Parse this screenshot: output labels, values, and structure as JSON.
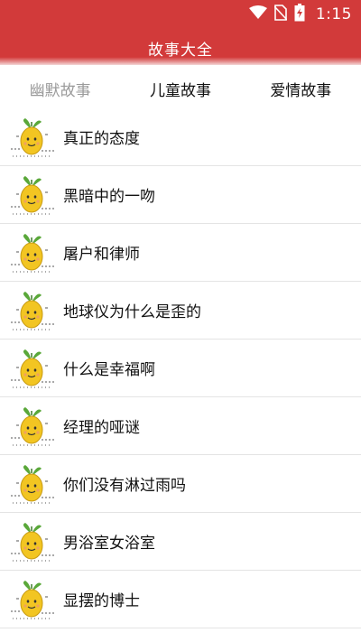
{
  "status_bar": {
    "time": "1:15",
    "icons": [
      "wifi-icon",
      "no-sim-icon",
      "battery-charging-icon"
    ]
  },
  "header": {
    "title": "故事大全"
  },
  "tabs": [
    {
      "label": "幽默故事",
      "active": true
    },
    {
      "label": "儿童故事",
      "active": false
    },
    {
      "label": "爱情故事",
      "active": false
    }
  ],
  "stories": [
    {
      "title": "真正的态度",
      "icon": "lemon-thumbnail-icon"
    },
    {
      "title": "黑暗中的一吻",
      "icon": "lemon-thumbnail-icon"
    },
    {
      "title": "屠户和律师",
      "icon": "lemon-thumbnail-icon"
    },
    {
      "title": "地球仪为什么是歪的",
      "icon": "lemon-thumbnail-icon"
    },
    {
      "title": "什么是幸福啊",
      "icon": "lemon-thumbnail-icon"
    },
    {
      "title": "经理的哑谜",
      "icon": "lemon-thumbnail-icon"
    },
    {
      "title": "你们没有淋过雨吗",
      "icon": "lemon-thumbnail-icon"
    },
    {
      "title": "男浴室女浴室",
      "icon": "lemon-thumbnail-icon"
    },
    {
      "title": "显摆的博士",
      "icon": "lemon-thumbnail-icon"
    }
  ],
  "colors": {
    "header_red": "#d23a3a",
    "active_tab_gray": "#9a9a9a",
    "text_dark": "#111111",
    "divider": "#e4e4e4",
    "lemon_yellow": "#f2c522"
  }
}
